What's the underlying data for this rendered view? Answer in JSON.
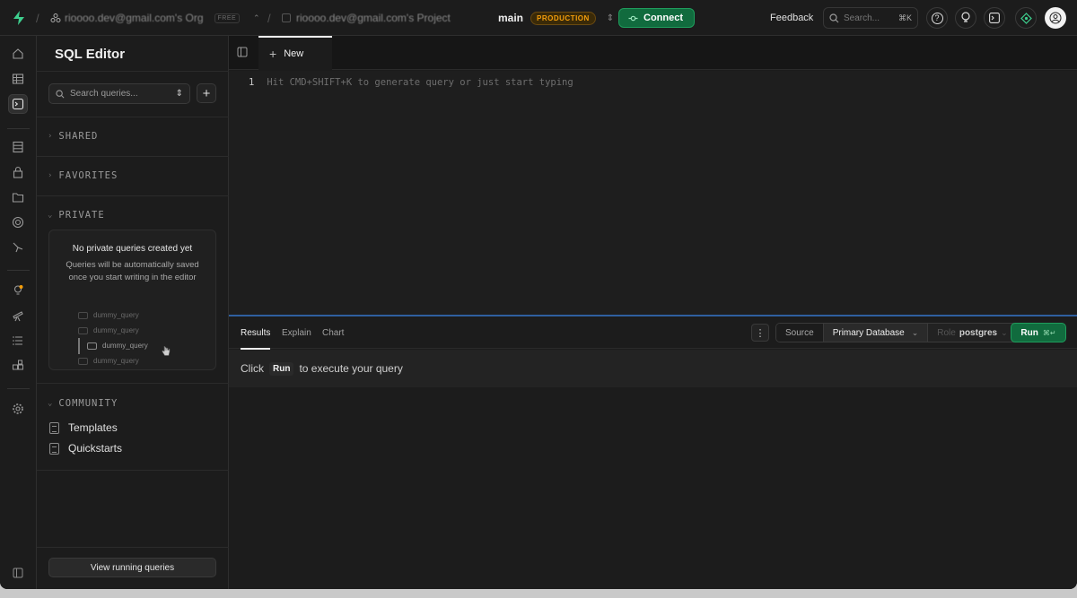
{
  "topbar": {
    "org_name": "rioooo.dev@gmail.com's Org",
    "org_plan": "FREE",
    "project_name": "rioooo.dev@gmail.com's Project",
    "branch": "main",
    "environment_badge": "PRODUCTION",
    "connect_label": "Connect",
    "feedback_label": "Feedback",
    "search_placeholder": "Search...",
    "search_shortcut": "⌘K"
  },
  "sidebar": {
    "title": "SQL Editor",
    "search_placeholder": "Search queries...",
    "sections": {
      "shared": "SHARED",
      "favorites": "FAVORITES",
      "private": "PRIVATE",
      "community": "COMMUNITY"
    },
    "empty_state": {
      "title": "No private queries created yet",
      "subtitle": "Queries will be automatically saved once you start writing in the editor"
    },
    "dummy_queries": [
      "dummy_query",
      "dummy_query",
      "dummy_query",
      "dummy_query"
    ],
    "community_items": [
      "Templates",
      "Quickstarts"
    ],
    "view_running_label": "View running queries"
  },
  "editor": {
    "tab_label": "New",
    "line_number": "1",
    "placeholder": "Hit CMD+SHIFT+K to generate query or just start typing"
  },
  "results": {
    "tabs": [
      "Results",
      "Explain",
      "Chart"
    ],
    "source_label": "Source",
    "database": "Primary Database",
    "role_label": "Role",
    "role_value": "postgres",
    "run_label": "Run",
    "run_shortcut": "⌘↵",
    "message_prefix": "Click",
    "message_keyword": "Run",
    "message_suffix": "to execute your query"
  },
  "colors": {
    "brand_green": "#3ecf8e",
    "run_green": "#116b3e",
    "production_amber": "#f59e0b"
  }
}
